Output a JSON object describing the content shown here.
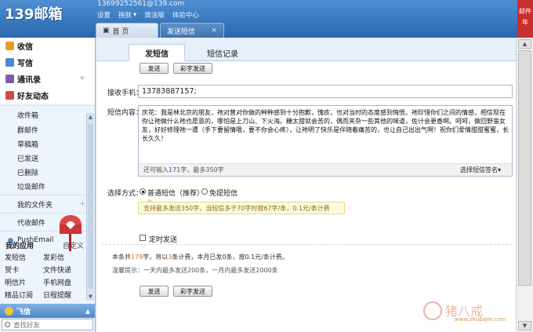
{
  "header": {
    "logo": "139邮箱",
    "user_email": "13699252561@139.com",
    "links": [
      {
        "label": "设置",
        "icon": ""
      },
      {
        "label": "换肤",
        "icon": "chevron-down-icon"
      },
      {
        "label": "简洁版",
        "icon": ""
      },
      {
        "label": "体验中心",
        "icon": ""
      }
    ],
    "tabs": [
      {
        "label": "首 页",
        "icon": "home-icon"
      },
      {
        "label": "发送短信",
        "close": "×"
      }
    ],
    "corner_label": "邮件",
    "corner_label2": "年"
  },
  "sidebar": {
    "quick": [
      {
        "label": "收信",
        "icon": "inbox-icon",
        "color": "#e99a2b",
        "plus": ""
      },
      {
        "label": "写信",
        "icon": "compose-icon",
        "color": "#4a8ad4",
        "plus": ""
      },
      {
        "label": "通讯录",
        "icon": "contacts-icon",
        "color": "#7b5da8",
        "plus": "+"
      },
      {
        "label": "好友动态",
        "icon": "friends-icon",
        "color": "#d14a4a",
        "plus": ""
      }
    ],
    "folders": [
      "收件箱",
      "群邮件",
      "草稿箱",
      "已发送",
      "已删除",
      "垃圾邮件"
    ],
    "my_folders": {
      "label": "我的文件夹",
      "plus": "+"
    },
    "extra_folders": [
      "代收邮件"
    ],
    "push_email": "PushEmail",
    "apps_title": "我的应用",
    "apps_custom": "自定义",
    "apps": [
      "发短信",
      "发彩信",
      "贺卡",
      "文件快递",
      "明信片",
      "手机网盘",
      "精品订阅",
      "日程提醒"
    ],
    "feixin": {
      "label": "飞信",
      "caret": "▲"
    },
    "friend_search_placeholder": "查找好友"
  },
  "main": {
    "subtabs": [
      "发短信",
      "短信记录"
    ],
    "buttons": {
      "send": "发送",
      "save_draft": "彩字发送"
    },
    "recipient_label": "接收手机：",
    "recipient_value": "13783887157;",
    "content_label": "短信内容：",
    "content_text": "庆花：我是林北京的朋友，祂对曾对你做的种种感到十分抱歉，愧疚，也对当时的态度感到悔恨。祂珍惜你们之间的情感，相信现在你让祂做什么祂也愿意的，哪怕是上刀山、下火海。糖太甜就会苦的，偶而夹杂一些其他的味道，佐计会更香啊。呵呵，做回野蛮女友，好好修理祂一遭（手下要留情哦，要不你会心疼），让祂明了快乐是伴随着痛苦的，也让自己出出气啊！祝你们爱情甜甜蜜蜜，长长久久！",
    "remaining_prefix": "还可输入",
    "remaining_count": "171",
    "remaining_suffix": "字，最多350字",
    "signature": "选择短信签名▾",
    "send_mode_label": "选择方式：",
    "mode_normal": "普通短信（推荐）",
    "mode_long": "免提短信",
    "tip": "支持最多发送350字，当短信多于70字时按67字/条，0.1元/条计费",
    "timed_send": "定时发送",
    "summary_prefix": "本条共",
    "summary_chars": "179",
    "summary_mid": "字，将以",
    "summary_count": "3",
    "summary_suffix": "条计费，本月已发0条，按0.1元/条计费。",
    "warm_tip": "温馨提示：一天内最多发送200条，一月内最多发送2000条"
  },
  "watermark": {
    "site": "www.zhubajie.com"
  }
}
